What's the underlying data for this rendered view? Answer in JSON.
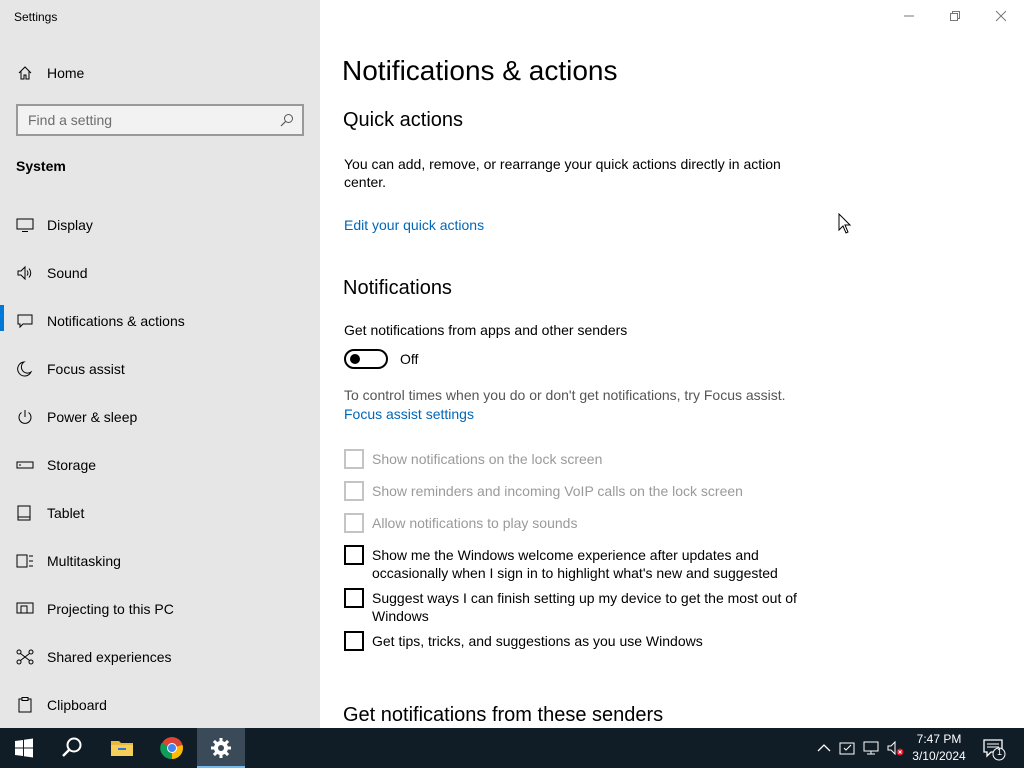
{
  "window": {
    "title": "Settings"
  },
  "sidebar": {
    "home_label": "Home",
    "search_placeholder": "Find a setting",
    "section_label": "System",
    "items": [
      {
        "label": "Display",
        "icon": "monitor-icon"
      },
      {
        "label": "Sound",
        "icon": "speaker-icon"
      },
      {
        "label": "Notifications & actions",
        "icon": "notification-icon"
      },
      {
        "label": "Focus assist",
        "icon": "moon-icon"
      },
      {
        "label": "Power & sleep",
        "icon": "power-icon"
      },
      {
        "label": "Storage",
        "icon": "storage-icon"
      },
      {
        "label": "Tablet",
        "icon": "tablet-icon"
      },
      {
        "label": "Multitasking",
        "icon": "multitasking-icon"
      },
      {
        "label": "Projecting to this PC",
        "icon": "projecting-icon"
      },
      {
        "label": "Shared experiences",
        "icon": "shared-icon"
      },
      {
        "label": "Clipboard",
        "icon": "clipboard-icon"
      }
    ],
    "active_index": 2
  },
  "main": {
    "title": "Notifications & actions",
    "quick_actions": {
      "heading": "Quick actions",
      "description": "You can add, remove, or rearrange your quick actions directly in action center.",
      "link": "Edit your quick actions"
    },
    "notifications": {
      "heading": "Notifications",
      "toggle_label": "Get notifications from apps and other senders",
      "toggle_state": "Off",
      "focus_text": "To control times when you do or don't get notifications, try Focus assist.",
      "focus_link": "Focus assist settings",
      "checkboxes": [
        {
          "label": "Show notifications on the lock screen",
          "checked": false,
          "enabled": false
        },
        {
          "label": "Show reminders and incoming VoIP calls on the lock screen",
          "checked": false,
          "enabled": false
        },
        {
          "label": "Allow notifications to play sounds",
          "checked": false,
          "enabled": false
        },
        {
          "label": "Show me the Windows welcome experience after updates and occasionally when I sign in to highlight what's new and suggested",
          "checked": false,
          "enabled": true
        },
        {
          "label": "Suggest ways I can finish setting up my device to get the most out of Windows",
          "checked": false,
          "enabled": true
        },
        {
          "label": "Get tips, tricks, and suggestions as you use Windows",
          "checked": false,
          "enabled": true
        }
      ]
    },
    "senders_heading": "Get notifications from these senders"
  },
  "taskbar": {
    "apps": [
      "start-icon",
      "search-icon",
      "file-explorer-icon",
      "chrome-icon",
      "settings-icon"
    ],
    "time": "7:47 PM",
    "date": "3/10/2024",
    "notification_count": "1"
  },
  "colors": {
    "accent": "#0078d7",
    "link": "#0067b8",
    "taskbar": "#101c26",
    "sidebar": "#e6e6e6"
  }
}
